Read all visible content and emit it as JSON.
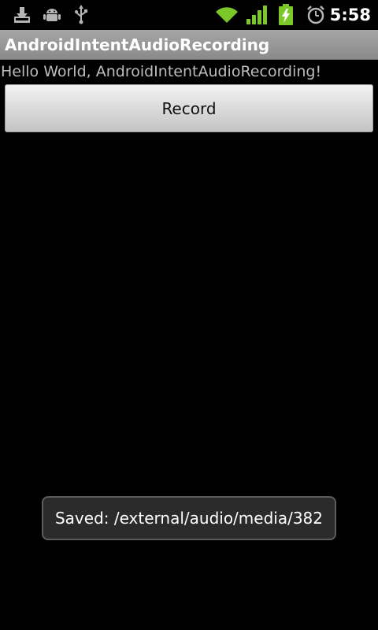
{
  "status_bar": {
    "time": "5:58",
    "icons": [
      "download-icon",
      "android-debug-icon",
      "usb-icon",
      "wifi-icon",
      "signal-icon",
      "battery-charging-icon",
      "alarm-icon"
    ]
  },
  "title_bar": {
    "title": "AndroidIntentAudioRecording"
  },
  "main": {
    "greeting": "Hello World, AndroidIntentAudioRecording!",
    "record_button_label": "Record"
  },
  "toast": {
    "message": "Saved: /external/audio/media/382"
  },
  "colors": {
    "title_bar_bg": "#9a9a9a",
    "background": "#000000",
    "wifi_green": "#7dc829",
    "toast_bg": "#2b2b2b"
  }
}
